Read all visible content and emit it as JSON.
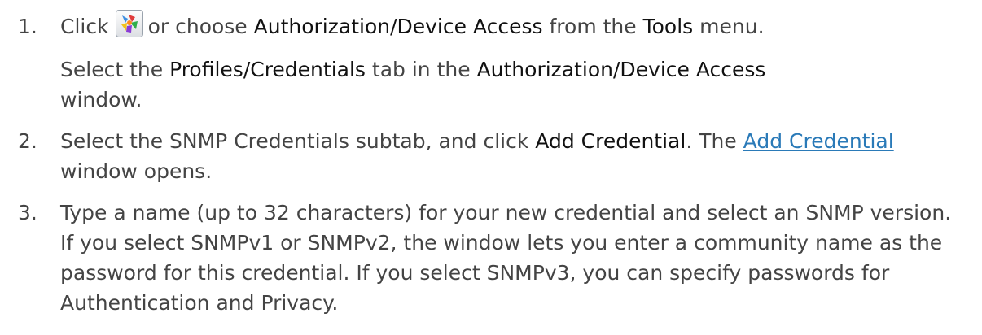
{
  "icons": {
    "tool_icon": "authorization-device-access-icon"
  },
  "steps": [
    {
      "number": "1.",
      "p1": {
        "t1": "Click",
        "t2": "or choose",
        "b1": "Authorization/Device Access",
        "t3": "from the",
        "b2": "Tools",
        "t4": "menu."
      },
      "p2": {
        "t1": "Select the",
        "b1": "Profiles/Credentials",
        "t2": "tab in the",
        "b2": "Authorization/Device Access",
        "t3": "window."
      }
    },
    {
      "number": "2.",
      "t1": "Select the SNMP Credentials subtab, and click",
      "b1": "Add Credential",
      "t2": ". The",
      "link": "Add Credential",
      "t3": "window opens."
    },
    {
      "number": "3.",
      "text": "Type a name (up to 32 characters) for your new credential and select an SNMP version. If you select SNMPv1 or SNMPv2, the window lets you enter a community name as the password for this credential. If you select SNMPv3, you can specify passwords for Authentication and Privacy."
    }
  ]
}
